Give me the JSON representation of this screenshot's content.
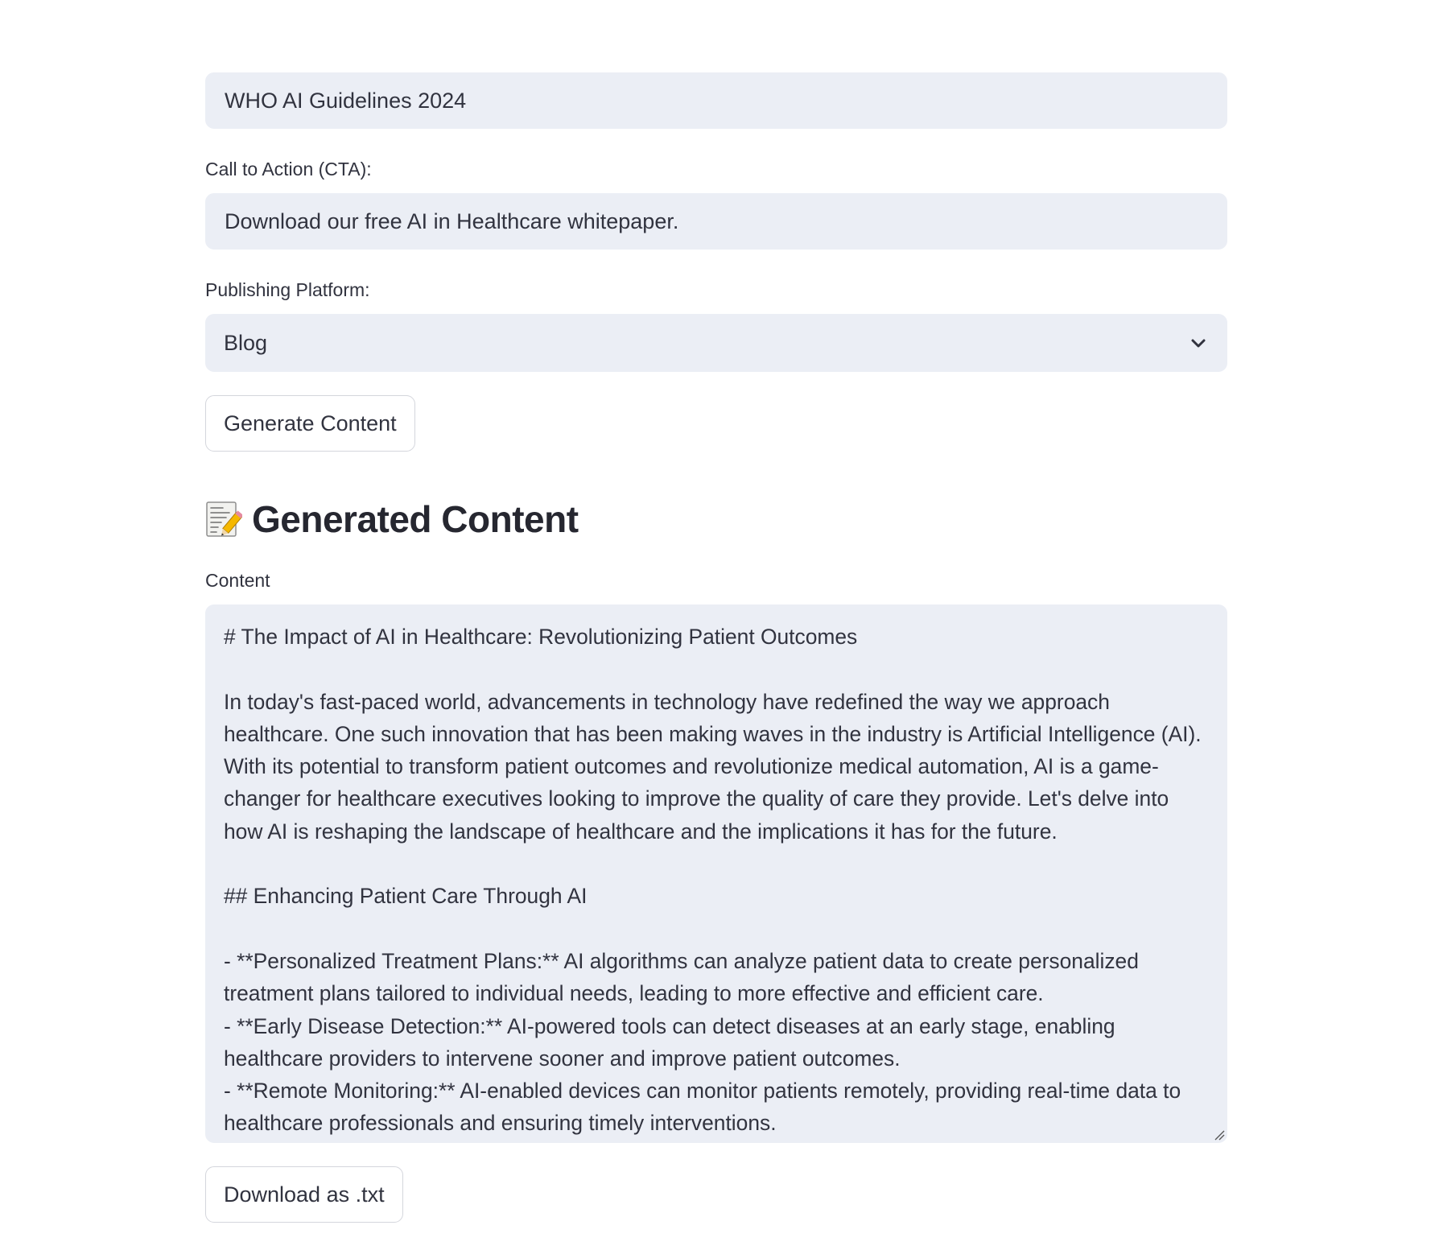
{
  "form": {
    "source_value": "WHO AI Guidelines 2024",
    "cta_label": "Call to Action (CTA):",
    "cta_value": "Download our free AI in Healthcare whitepaper.",
    "platform_label": "Publishing Platform:",
    "platform_selected": "Blog",
    "generate_button": "Generate Content"
  },
  "output": {
    "heading_icon": "memo-icon",
    "heading": "Generated Content",
    "content_label": "Content",
    "content_text": "# The Impact of AI in Healthcare: Revolutionizing Patient Outcomes\n\nIn today's fast-paced world, advancements in technology have redefined the way we approach healthcare. One such innovation that has been making waves in the industry is Artificial Intelligence (AI). With its potential to transform patient outcomes and revolutionize medical automation, AI is a game-changer for healthcare executives looking to improve the quality of care they provide. Let's delve into how AI is reshaping the landscape of healthcare and the implications it has for the future.\n\n## Enhancing Patient Care Through AI\n\n- **Personalized Treatment Plans:** AI algorithms can analyze patient data to create personalized treatment plans tailored to individual needs, leading to more effective and efficient care.\n- **Early Disease Detection:** AI-powered tools can detect diseases at an early stage, enabling healthcare providers to intervene sooner and improve patient outcomes.\n- **Remote Monitoring:** AI-enabled devices can monitor patients remotely, providing real-time data to healthcare professionals and ensuring timely interventions.",
    "download_button": "Download as .txt"
  },
  "colors": {
    "input_background": "#ebeef5",
    "text": "#31333f",
    "button_border": "#d4d6dc"
  }
}
